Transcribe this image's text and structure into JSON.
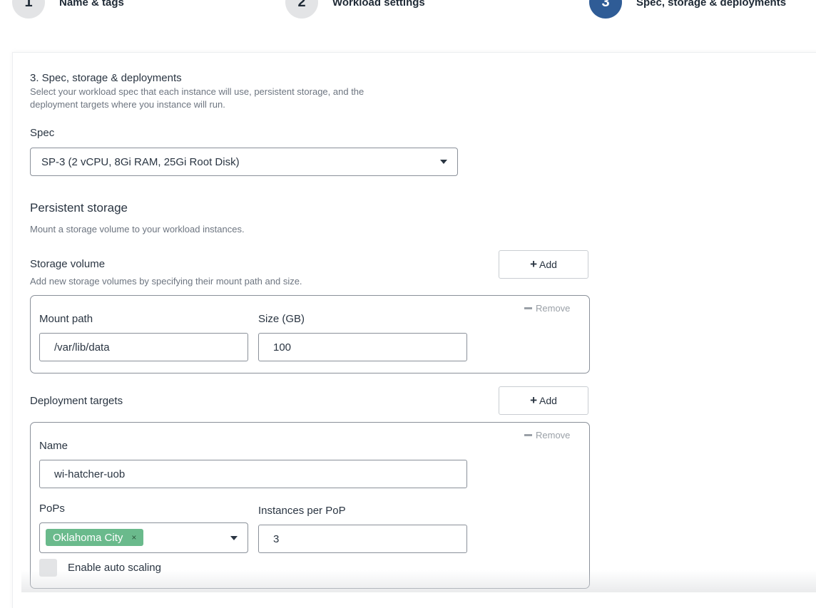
{
  "stepper": {
    "steps": [
      {
        "number": "1",
        "label": "Name & tags"
      },
      {
        "number": "2",
        "label": "Workload settings"
      },
      {
        "number": "3",
        "label": "Spec, storage & deployments"
      }
    ]
  },
  "section": {
    "title": "3. Spec, storage & deployments",
    "description_line1": "Select your workload spec that each instance will use, persistent storage, and the",
    "description_line2": "deployment targets where you instance will run."
  },
  "spec": {
    "label": "Spec",
    "selected": "SP-3 (2 vCPU, 8Gi RAM, 25Gi Root Disk)"
  },
  "persistent_storage": {
    "title": "Persistent storage",
    "description": "Mount a storage volume to your workload instances."
  },
  "storage_volume": {
    "label": "Storage volume",
    "description": "Add new storage volumes by specifying their mount path and size.",
    "add_label": "Add",
    "remove_label": "Remove",
    "mount_path_label": "Mount path",
    "mount_path_value": "/var/lib/data",
    "size_label": "Size (GB)",
    "size_value": "100"
  },
  "deployment_targets": {
    "label": "Deployment targets",
    "add_label": "Add",
    "remove_label": "Remove",
    "name_label": "Name",
    "name_value": "wi-hatcher-uob",
    "pops_label": "PoPs",
    "pops_selected": [
      "Oklahoma City"
    ],
    "tag_remove": "×",
    "instances_label": "Instances per PoP",
    "instances_value": "3",
    "autoscaling_label": "Enable auto scaling"
  },
  "colors": {
    "active_step": "#2f5c96",
    "inactive_step": "#e3e4e6",
    "tag": "#6aba8c"
  }
}
